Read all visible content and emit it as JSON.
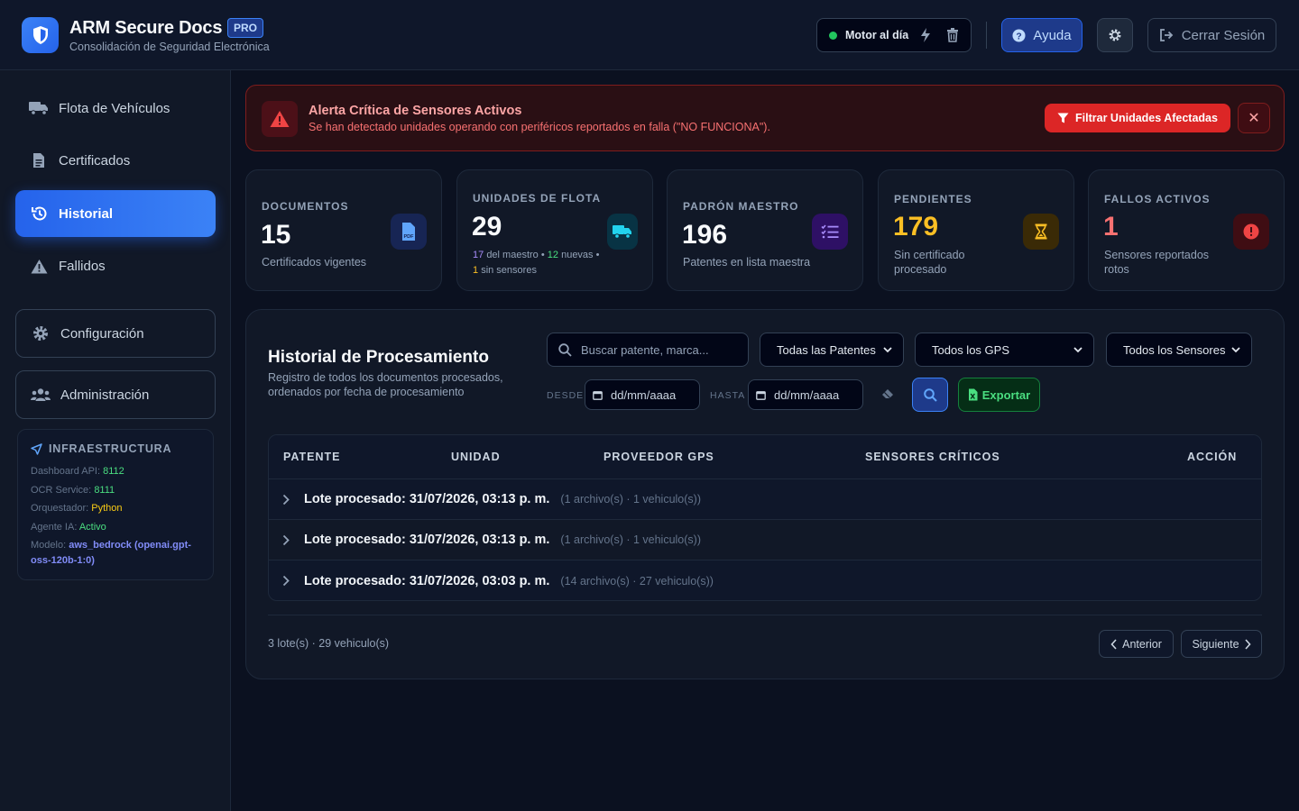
{
  "header": {
    "title": "ARM Secure Docs",
    "badge": "PRO",
    "subtitle": "Consolidación de Seguridad Electrónica",
    "engine_status": "Motor al día",
    "help_label": "Ayuda",
    "logout_label": "Cerrar Sesión"
  },
  "sidebar": {
    "items": [
      {
        "label": "Flota de Vehículos",
        "icon": "truck-icon"
      },
      {
        "label": "Certificados",
        "icon": "file-icon"
      },
      {
        "label": "Historial",
        "icon": "history-icon",
        "active": true
      },
      {
        "label": "Fallidos",
        "icon": "warning-icon"
      }
    ],
    "boxes": [
      {
        "label": "Configuración",
        "icon": "gear-icon"
      },
      {
        "label": "Administración",
        "icon": "users-icon"
      }
    ],
    "infra": {
      "title": "INFRAESTRUCTURA",
      "dashboard_label": "Dashboard API:",
      "dashboard_value": "8112",
      "ocr_label": "OCR Service:",
      "ocr_value": "8111",
      "orq_label": "Orquestador:",
      "orq_value": "Python",
      "agent_label": "Agente IA:",
      "agent_value": "Activo",
      "model_label": "Modelo:",
      "model_value": "aws_bedrock (openai.gpt-oss-120b-1:0)"
    }
  },
  "alert": {
    "title": "Alerta Crítica de Sensores Activos",
    "description": "Se han detectado unidades operando con periféricos reportados en falla (\"NO FUNCIONA\").",
    "filter_label": "Filtrar Unidades Afectadas",
    "close_label": "✕"
  },
  "stats": {
    "documents": {
      "label": "DOCUMENTOS",
      "value": "15",
      "sub": "Certificados vigentes"
    },
    "fleet": {
      "label": "UNIDADES DE FLOTA",
      "value": "29",
      "master_count": "17",
      "master_text": "del maestro",
      "new_count": "12",
      "new_text": "nuevas",
      "no_sensor_count": "1",
      "no_sensor_text": "sin sensores"
    },
    "master": {
      "label": "PADRÓN MAESTRO",
      "value": "196",
      "sub": "Patentes en lista maestra"
    },
    "pending": {
      "label": "PENDIENTES",
      "value": "179",
      "sub": "Sin certificado procesado"
    },
    "failures": {
      "label": "FALLOS ACTIVOS",
      "value": "1",
      "sub": "Sensores reportados rotos"
    }
  },
  "panel": {
    "title": "Historial de Procesamiento",
    "description": "Registro de todos los documentos procesados, ordenados por fecha de procesamiento",
    "search_placeholder": "Buscar patente, marca...",
    "filter_patentes": "Todas las Patentes",
    "filter_gps": "Todos los GPS",
    "filter_sensores": "Todos los Sensores",
    "desde_label": "DESDE",
    "hasta_label": "HASTA",
    "date_placeholder": "dd/mm/aaaa",
    "export_label": "Exportar",
    "columns": [
      "PATENTE",
      "UNIDAD",
      "PROVEEDOR GPS",
      "SENSORES CRÍTICOS",
      "ACCIÓN"
    ],
    "rows": [
      {
        "title": "Lote procesado: 31/07/2026, 03:13 p. m.",
        "meta": "(1 archivo(s) · 1 vehiculo(s))"
      },
      {
        "title": "Lote procesado: 31/07/2026, 03:13 p. m.",
        "meta": "(1 archivo(s) · 1 vehiculo(s))"
      },
      {
        "title": "Lote procesado: 31/07/2026, 03:03 p. m.",
        "meta": "(14 archivo(s) · 27 vehiculo(s))"
      }
    ],
    "footer_count": "3 lote(s) · 29 vehiculo(s)",
    "prev_label": "Anterior",
    "next_label": "Siguiente"
  },
  "colors": {
    "accent": "#3b82f6",
    "danger": "#dc2626",
    "warning": "#fbbf24",
    "success": "#22c55e"
  }
}
